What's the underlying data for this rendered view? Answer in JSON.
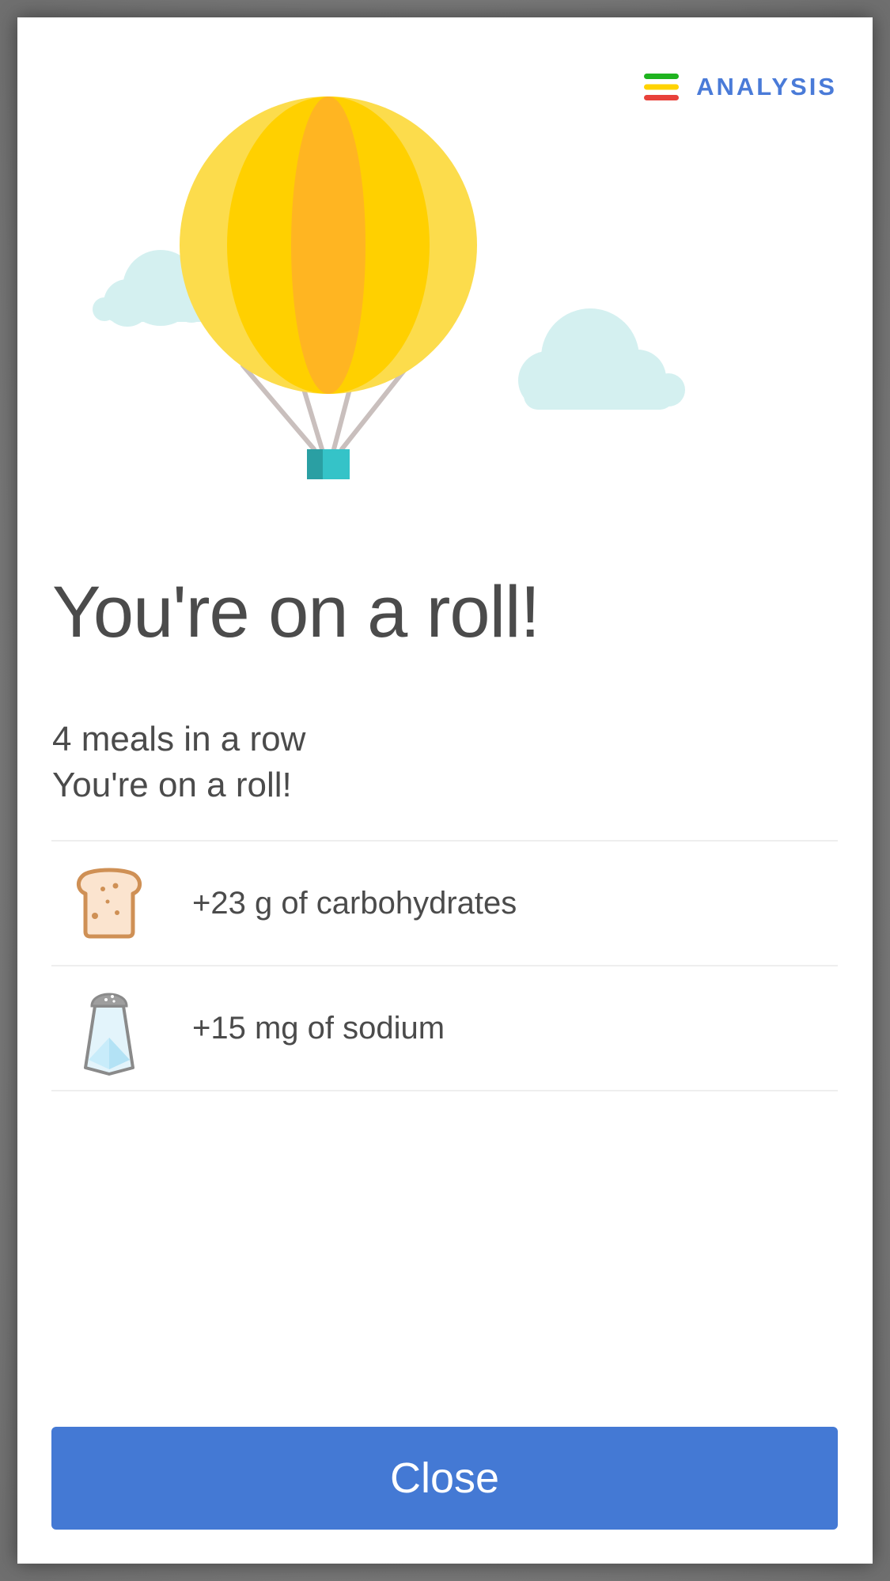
{
  "header": {
    "analysis_label": "ANALYSIS",
    "analysis_icon": "traffic-light-bars-icon",
    "analysis_icon_colors": [
      "#1fb31f",
      "#ffd300",
      "#e8413a"
    ],
    "accent_color": "#4a7bd8"
  },
  "illustration": {
    "name": "hot-air-balloon-with-clouds",
    "balloon_colors": [
      "#fcdc4c",
      "#ffd000",
      "#ffb522"
    ],
    "basket_color": "#35c3c8",
    "cloud_color": "#d4f0f0"
  },
  "main": {
    "title": "You're on a roll!",
    "subtitle_line1": "4 meals in a row",
    "subtitle_line2": "You're on a roll!"
  },
  "stats": [
    {
      "icon": "bread-slice-icon",
      "text": "+23 g of carbohydrates"
    },
    {
      "icon": "salt-shaker-icon",
      "text": "+15 mg of sodium"
    }
  ],
  "footer": {
    "close_label": "Close",
    "button_color": "#4479d4"
  }
}
